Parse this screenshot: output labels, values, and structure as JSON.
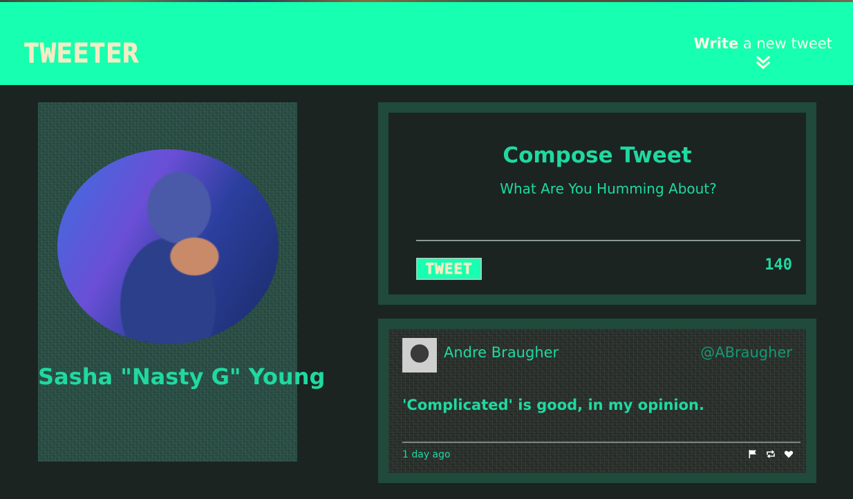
{
  "header": {
    "brand": "Tweeter",
    "write_bold": "Write",
    "write_rest": " a new tweet",
    "chevron_icon": "double-chevron-down-icon",
    "bg_color": "#17ffb0"
  },
  "profile": {
    "name": "Sasha \"Nasty G\" Young"
  },
  "compose": {
    "title": "Compose Tweet",
    "placeholder": "What Are You Humming About?",
    "button_label": "Tweet",
    "counter": "140"
  },
  "tweets": [
    {
      "author": "Andre Braugher",
      "handle": "@ABraugher",
      "text": "'Complicated' is good, in my opinion.",
      "time": "1 day ago",
      "actions": [
        "flag-icon",
        "retweet-icon",
        "heart-icon"
      ]
    }
  ],
  "colors": {
    "accent": "#1fd9a0",
    "background": "#1b2421",
    "panel_border": "#1f4a3c",
    "cream": "#f4ecc4"
  }
}
